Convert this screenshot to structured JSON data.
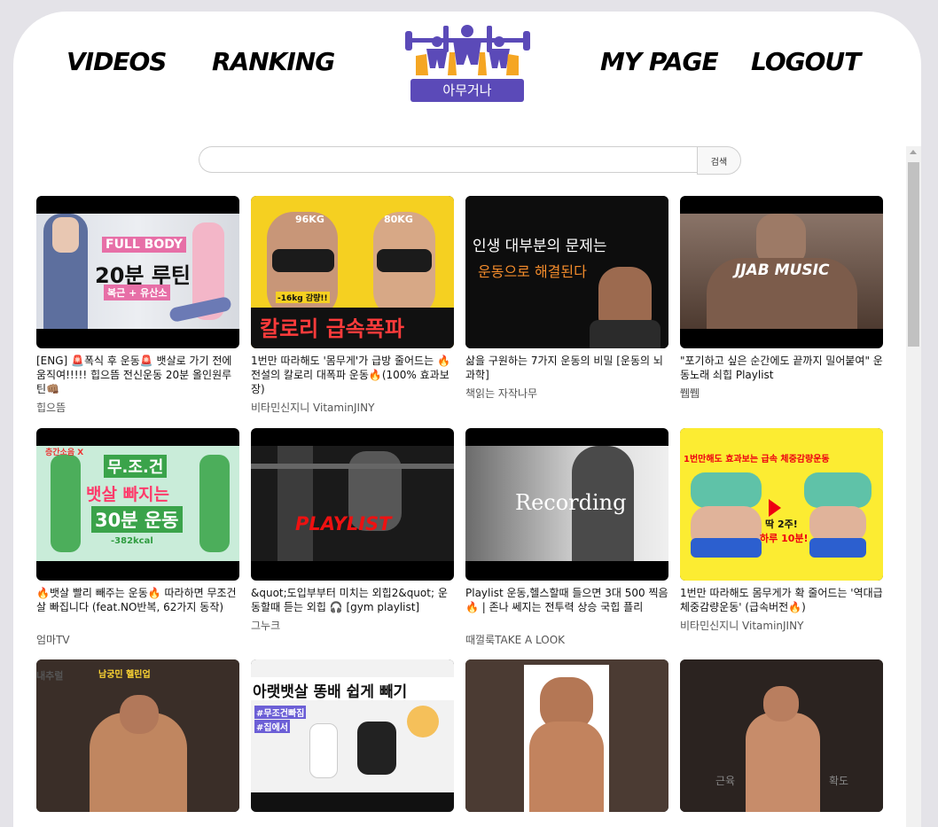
{
  "nav": {
    "videos": "VIDEOS",
    "ranking": "RANKING",
    "mypage": "MY PAGE",
    "logout": "LOGOUT"
  },
  "logo": {
    "text": "아무거나"
  },
  "search": {
    "button_label": "검색",
    "placeholder": ""
  },
  "colors": {
    "brand": "#5b4ab8",
    "accent": "#f5a623"
  },
  "videos": [
    {
      "title": "[ENG] 🚨폭식 후 운동🚨 뱃살로 가기 전에 움직여!!!!! 힙으뜸 전신운동 20분 올인원루틴👊🏽",
      "channel": "힙으뜸",
      "overlay": [
        "FULL BODY",
        "20분 루틴",
        "복근 + 유산소"
      ]
    },
    {
      "title": "1번만 따라해도 '몸무게'가 급방 줄어드는 🔥전설의 칼로리 대폭파 운동🔥(100% 효과보장)",
      "channel": "비타민신지니 VitaminJINY",
      "overlay": [
        "96KG",
        "80KG",
        "칼로리 급속폭파",
        "-16kg 감량!!"
      ]
    },
    {
      "title": "삶을 구원하는 7가지 운동의 비밀 [운동의 뇌과학]",
      "channel": "책읽는 자작나무",
      "overlay": [
        "인생 대부분의 문제는",
        "운동으로 해결된다"
      ]
    },
    {
      "title": "\"포기하고 싶은 순간에도 끝까지 밀어붙여\" 운동노래 쇠힙 Playlist",
      "channel": "쮑쮑",
      "overlay": [
        "JJAB MUSIC"
      ]
    },
    {
      "title": "🔥뱃살 빨리 빼주는 운동🔥 따라하면 무조건 살 빠집니다 (feat.NO반복, 62가지 동작)",
      "channel": "엄마TV",
      "overlay": [
        "무.조.건",
        "뱃살 빠지는",
        "30분 운동",
        "-382kcal",
        "층간소음 X"
      ]
    },
    {
      "title": "&quot;도입부부터 미치는 외힙2&quot; 운동할때 듣는 외힙 🎧 [gym playlist]",
      "channel": "그누크",
      "overlay": [
        "PLAYLIST"
      ]
    },
    {
      "title": "Playlist 운동,헬스할때 들으면 3대 500 찍음🔥 | 존나 쎄지는 전투력 상승 국힙 플리",
      "channel": "때껄룩TAKE A LOOK",
      "overlay": [
        "Recording"
      ]
    },
    {
      "title": "1번만 따라해도 몸무게가 확 줄어드는 '역대급 체중감량운동' (급속버전🔥)",
      "channel": "비타민신지니 VitaminJINY",
      "overlay": [
        "1번만해도 효과보는 급속 체중감량운동",
        "딱 2주!",
        "하루 10분!"
      ]
    },
    {
      "title": "",
      "channel": "",
      "overlay": [
        "남궁민 헬린업",
        "내추럴"
      ]
    },
    {
      "title": "",
      "channel": "",
      "overlay": [
        "아랫뱃살 똥배 쉽게 빼기",
        "#무조건빠짐",
        "#집에서"
      ]
    },
    {
      "title": "",
      "channel": "",
      "overlay": []
    },
    {
      "title": "",
      "channel": "",
      "overlay": [
        "근육",
        "확도"
      ]
    }
  ]
}
